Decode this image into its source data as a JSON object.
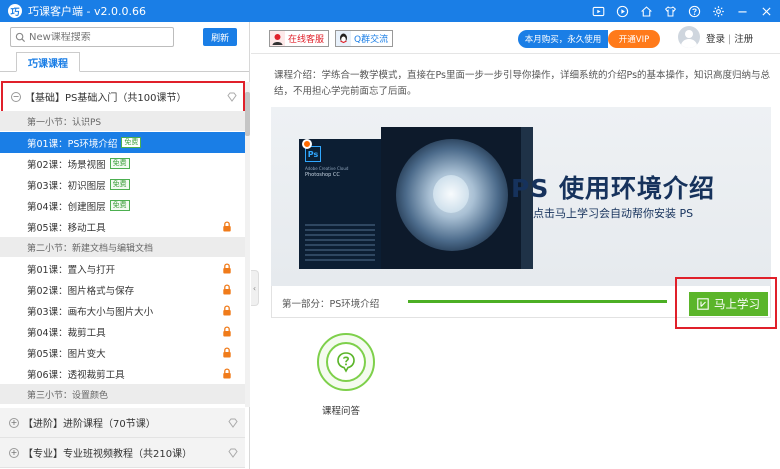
{
  "titlebar": {
    "title": "巧课客户端 - v2.0.0.66",
    "icons": [
      "video-icon",
      "play-icon",
      "home-icon",
      "shirt-icon",
      "help-icon",
      "settings-icon",
      "minimize-icon",
      "close-icon"
    ]
  },
  "sidebar": {
    "search_placeholder": "New课程搜索",
    "refresh_label": "刷新",
    "tab_label": "巧课课程",
    "courses": [
      {
        "label": "【基础】PS基础入门（共100课节）",
        "expanded": true,
        "sections": [
          {
            "title": "第一小节：认识PS",
            "lessons": [
              {
                "label": "第01课：PS环境介绍",
                "badge": "免费",
                "active": true
              },
              {
                "label": "第02课：场景视图",
                "badge": "免费"
              },
              {
                "label": "第03课：初识图层",
                "badge": "免费"
              },
              {
                "label": "第04课：创建图层",
                "badge": "免费"
              },
              {
                "label": "第05课：移动工具",
                "locked": true
              }
            ]
          },
          {
            "title": "第二小节：新建文档与编辑文档",
            "lessons": [
              {
                "label": "第01课：置入与打开",
                "locked": true
              },
              {
                "label": "第02课：图片格式与保存",
                "locked": true
              },
              {
                "label": "第03课：画布大小与图片大小",
                "locked": true
              },
              {
                "label": "第04课：裁剪工具",
                "locked": true
              },
              {
                "label": "第05课：图片变大",
                "locked": true
              },
              {
                "label": "第06课：透视裁剪工具",
                "locked": true
              }
            ]
          },
          {
            "title": "第三小节：设置颜色",
            "lessons": []
          }
        ]
      },
      {
        "label": "【进阶】进阶课程（70节课）",
        "expanded": false
      },
      {
        "label": "【专业】专业班视频教程（共210课）",
        "expanded": false
      }
    ]
  },
  "header": {
    "service_label": "在线客服",
    "group_label": "Q群交流",
    "promo_text": "本月购买，永久使用",
    "vip_label": "开通VIP",
    "login_label": "登录",
    "divider": "|",
    "register_label": "注册"
  },
  "content": {
    "description": "课程介绍：学练合一教学模式，直接在Ps里面一步一步引导你操作，详细系统的介绍Ps的基本操作，知识高度归纳与总结，不用担心学完前面忘了后面。",
    "banner": {
      "title": "PS 使用环境介绍",
      "subtitle": "点击马上学习会自动帮你安装 PS",
      "ps_logo": "Ps",
      "ps_product_line1": "Adobe Creative Cloud",
      "ps_product_line2": "Photoshop CC"
    },
    "part_label": "第一部分：PS环境介绍",
    "progress_fraction": 1.0,
    "learn_button": "马上学习",
    "qa_label": "课程问答"
  },
  "colors": {
    "brand_blue": "#1a7ee6",
    "accent_green": "#5bb52a",
    "vip_orange": "#ff7a1a",
    "highlight_red": "#e0202a"
  }
}
